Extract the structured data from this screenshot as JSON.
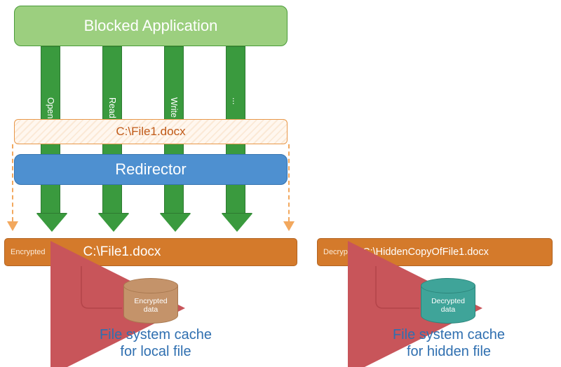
{
  "blocked_app": {
    "label": "Blocked Application"
  },
  "ops": {
    "open": "Open",
    "read": "Read",
    "write": "Write",
    "more": "..."
  },
  "orig_file": {
    "path": "C:\\File1.docx"
  },
  "redirector": {
    "label": "Redirector"
  },
  "enc_bar": {
    "tag": "Encrypted",
    "path": "C:\\File1.docx"
  },
  "dec_bar": {
    "tag": "Decrypted",
    "path": "C:\\HiddenCopyOfFile1.docx"
  },
  "cyl_enc": {
    "line1": "Encrypted",
    "line2": "data"
  },
  "cyl_dec": {
    "line1": "Decrypted",
    "line2": "data"
  },
  "footer": {
    "local_l1": "File system cache",
    "local_l2": "for local file",
    "hidden_l1": "File system cache",
    "hidden_l2": "for hidden file"
  },
  "colors": {
    "green": "#3a9a3e",
    "blue": "#4e90d0",
    "orange": "#d47a2b",
    "brown_cyl": "#c4936a",
    "teal_cyl": "#3fa499",
    "red_arrow": "#c8555a"
  }
}
